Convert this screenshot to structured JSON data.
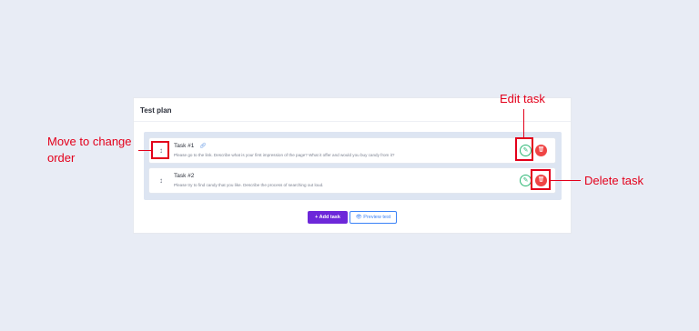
{
  "card": {
    "title": "Test plan"
  },
  "tasks": [
    {
      "name": "Task #1",
      "description": "Please go to the link. Describe what is your first impression of the page? What it offer and would you buy candy from it?",
      "handle_icon": "drag-vertical-icon",
      "link_icon": "link-icon",
      "edit_icon": "pencil-icon",
      "delete_icon": "trash-icon"
    },
    {
      "name": "Task #2",
      "description": "Please try to find candy that you like. Describe the process of searching out loud.",
      "handle_icon": "drag-vertical-icon",
      "edit_icon": "pencil-icon",
      "delete_icon": "trash-icon"
    }
  ],
  "actions": {
    "add_task_label": "+ Add task",
    "preview_label": "👁 Preview test"
  },
  "annotations": {
    "move": "Move to change order",
    "edit": "Edit task",
    "delete": "Delete task"
  },
  "colors": {
    "accent_purple": "#6d28d9",
    "preview_blue": "#3b82f6",
    "edit_green": "#2bb673",
    "delete_red": "#ef4444",
    "annotation_red": "#e3001b",
    "background": "#e8ecf5"
  }
}
